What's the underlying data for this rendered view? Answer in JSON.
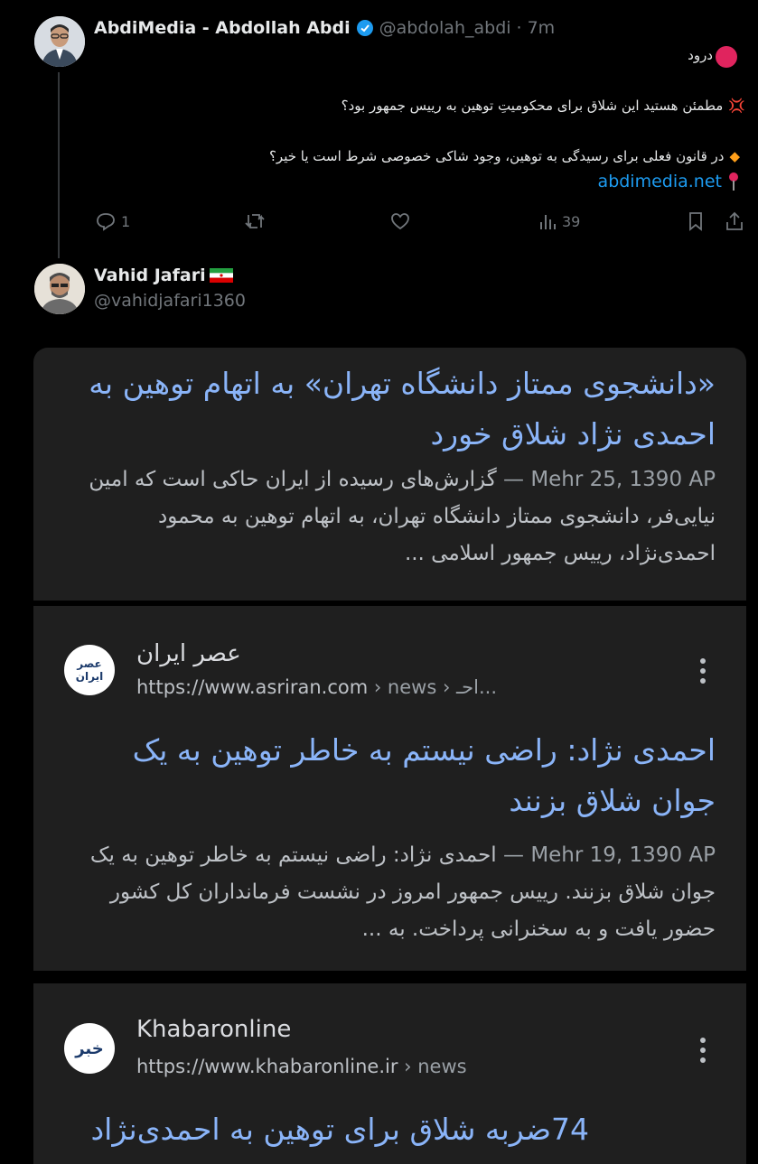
{
  "tweet1": {
    "display_name": "AbdiMedia - Abdollah Abdi",
    "handle": "@abdolah_abdi",
    "sep": "·",
    "time": "7m",
    "line1": "درود",
    "line2": "مطمئن هستید این شلاق برای محکومیتِ توهین به رییس جمهور بود؟",
    "line3": "در قانون فعلی برای رسیدگی به توهین، وجود شاکی خصوصی شرط است یا خیر؟",
    "link": "abdimedia.net",
    "replies": "1",
    "views": "39",
    "icons": {
      "line1": "red-circle-icon",
      "line2": "anger-icon",
      "line3": "orange-diamond-icon",
      "link": "pin-icon",
      "verified": "verified-badge-icon"
    }
  },
  "tweet2": {
    "display_name": "Vahid Jafari",
    "flag": "iran-flag-icon",
    "handle": "@vahidjafari1360"
  },
  "results": [
    {
      "title": "«دانشجوی ممتاز دانشگاه تهران» به اتهام توهین به احمدی نژاد شلاق خورد",
      "date": "Mehr 25, 1390 AP — ",
      "snippet": "گزارش‌های رسیده از ایران حاکی است که امین نیایی‌فر، دانشجوی ممتاز دانشگاه تهران، به اتهام توهین به محمود احمدی‌نژاد، رییس جمهور اسلامی ..."
    },
    {
      "site_name": "عصر ایران",
      "favicon_text": "عصر ایران",
      "url": "https://www.asriran.com",
      "url_path": " › news › احـ...",
      "title": "احمدی نژاد: راضی نیستم به خاطر توهین به یک جوان شلاق بزنند",
      "date": "Mehr 19, 1390 AP — ",
      "snippet": "احمدی نژاد: راضی نیستم به خاطر توهین به یک جوان شلاق بزنند. رییس جمهور امروز در نشست فرمانداران کل کشور حضور یافت و به سخنرانی پرداخت. به ..."
    },
    {
      "site_name": "Khabaronline",
      "favicon_text": "خبر",
      "url": "https://www.khabaronline.ir",
      "url_path": " › news",
      "title": "74ضربه شلاق برای توهین به احمدی‌نژاد"
    }
  ],
  "colors": {
    "link": "#1d9bf0",
    "result_title": "#8ab4f8",
    "card_bg": "#1f1f1f"
  }
}
